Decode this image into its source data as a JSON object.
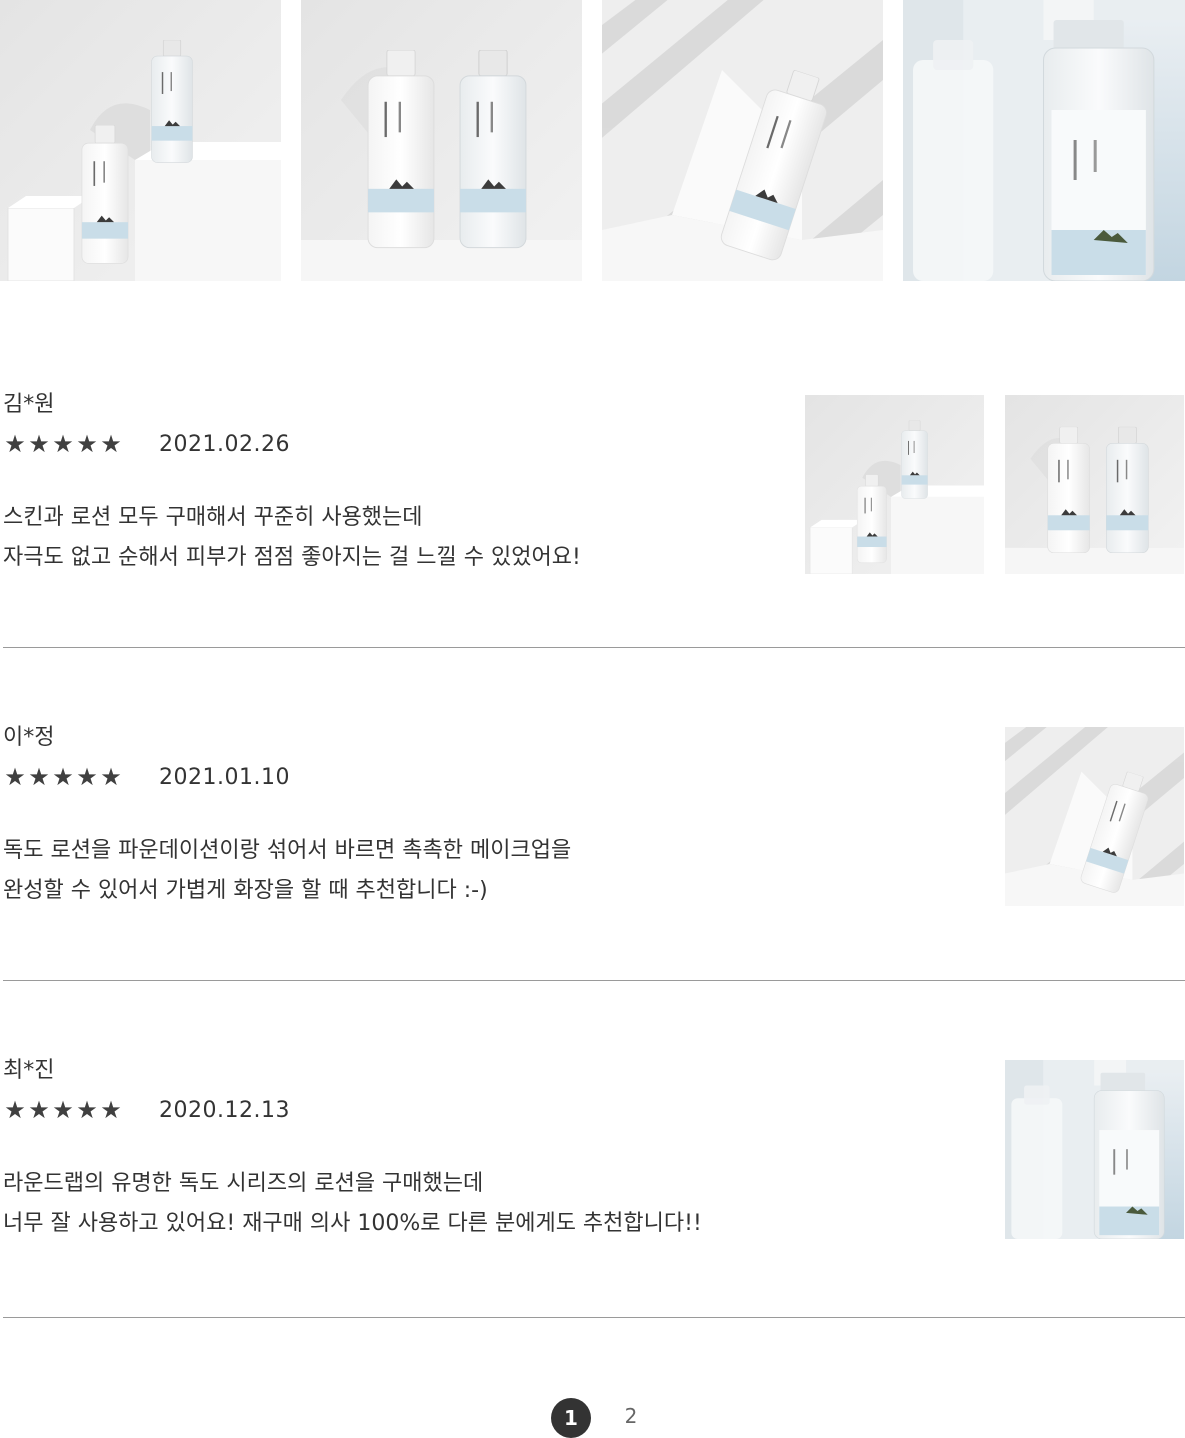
{
  "gallery": {
    "images": [
      {
        "name": "gallery-image-1",
        "scene": "two-bottles-on-blocks"
      },
      {
        "name": "gallery-image-2",
        "scene": "two-bottles-side-by-side"
      },
      {
        "name": "gallery-image-3",
        "scene": "tilted-bottle-with-shadows"
      },
      {
        "name": "gallery-image-4",
        "scene": "bottle-closeup"
      }
    ]
  },
  "reviews": [
    {
      "author": "김*원",
      "rating": 5,
      "stars": "★★★★★",
      "date": "2021.02.26",
      "lines": [
        "스킨과 로션 모두 구매해서 꾸준히 사용했는데",
        "자극도 없고 순해서 피부가 점점 좋아지는 걸 느낄 수 있었어요!"
      ],
      "photos": [
        "two-bottles-on-blocks",
        "two-bottles-side-by-side"
      ]
    },
    {
      "author": "이*정",
      "rating": 5,
      "stars": "★★★★★",
      "date": "2021.01.10",
      "lines": [
        "독도 로션을 파운데이션이랑 섞어서 바르면 촉촉한 메이크업을",
        "완성할 수 있어서 가볍게 화장을 할 때 추천합니다 :-)"
      ],
      "photos": [
        "tilted-bottle-with-shadows"
      ]
    },
    {
      "author": "최*진",
      "rating": 5,
      "stars": "★★★★★",
      "date": "2020.12.13",
      "lines": [
        "라운드랩의 유명한 독도 시리즈의 로션을 구매했는데",
        "너무 잘 사용하고 있어요! 재구매 의사 100%로 다른 분에게도 추천합니다!!"
      ],
      "photos": [
        "bottle-closeup"
      ]
    }
  ],
  "pagination": {
    "pages": [
      "1",
      "2"
    ],
    "current": "1"
  },
  "colors": {
    "text": "#333333",
    "star": "#404040",
    "divider": "#9a9a9a",
    "active_page_bg": "#333333",
    "label_blue": "#c9dde8"
  }
}
